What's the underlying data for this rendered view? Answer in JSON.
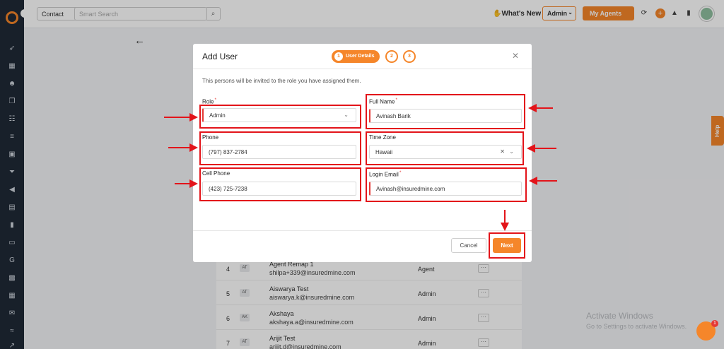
{
  "topbar": {
    "contact_select": "Contact",
    "search_placeholder": "Smart Search",
    "whats_new": "What's New",
    "admin_select": "Admin",
    "agents_button": "My Agents"
  },
  "background": {
    "rows": [
      {
        "num": "4",
        "initials": "AT",
        "name": "Agent Remap 1",
        "email": "shilpa+339@insuredmine.com",
        "role": "Agent"
      },
      {
        "num": "5",
        "initials": "AT",
        "name": "Aiswarya Test",
        "email": "aiswarya.k@insuredmine.com",
        "role": "Admin"
      },
      {
        "num": "6",
        "initials": "AK",
        "name": "Akshaya",
        "email": "akshaya.a@insuredmine.com",
        "role": "Admin"
      },
      {
        "num": "7",
        "initials": "AT",
        "name": "Arijit Test",
        "email": "arijit.d@insuredmine.com",
        "role": "Admin"
      }
    ],
    "help_tab": "Help",
    "activate_title": "Activate Windows",
    "activate_sub": "Go to Settings to activate Windows.",
    "chat_badge": "1"
  },
  "modal": {
    "title": "Add User",
    "steps": [
      {
        "num": "1",
        "label": "User Details"
      },
      {
        "num": "2"
      },
      {
        "num": "3"
      }
    ],
    "description": "This persons will be invited to the role you have assigned them.",
    "fields": {
      "role": {
        "label": "Role",
        "value": "Admin"
      },
      "full_name": {
        "label": "Full Name",
        "value": "Avinash Barik"
      },
      "phone": {
        "label": "Phone",
        "value": "(797) 837-2784"
      },
      "time_zone": {
        "label": "Time Zone",
        "value": "Hawaii"
      },
      "cell_phone": {
        "label": "Cell Phone",
        "value": "(423) 725-7238"
      },
      "login_email": {
        "label": "Login Email",
        "value": "Avinash@insuredmine.com"
      }
    },
    "cancel_label": "Cancel",
    "next_label": "Next"
  },
  "annotation_color": "#e3141a",
  "accent_color": "#f5862a"
}
